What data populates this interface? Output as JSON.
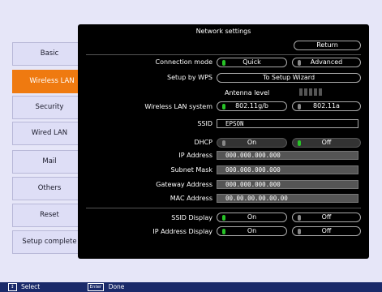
{
  "sidebar": {
    "items": [
      {
        "label": "Basic"
      },
      {
        "label": "Wireless LAN"
      },
      {
        "label": "Security"
      },
      {
        "label": "Wired LAN"
      },
      {
        "label": "Mail"
      },
      {
        "label": "Others"
      },
      {
        "label": "Reset"
      },
      {
        "label": "Setup complete"
      }
    ]
  },
  "panel": {
    "title": "Network settings",
    "return_label": "Return",
    "connection_mode": {
      "label": "Connection mode",
      "option1": "Quick",
      "option2": "Advanced"
    },
    "wps": {
      "label": "Setup by WPS",
      "button": "To Setup Wizard"
    },
    "antenna_label": "Antenna level",
    "wireless_system": {
      "label": "Wireless LAN system",
      "option1": "802.11g/b",
      "option2": "802.11a"
    },
    "ssid": {
      "label": "SSID",
      "value": "EPSON"
    },
    "dhcp": {
      "label": "DHCP",
      "option1": "On",
      "option2": "Off"
    },
    "ip": {
      "label": "IP Address",
      "value": "000.000.000.000"
    },
    "subnet": {
      "label": "Subnet Mask",
      "value": "000.000.000.000"
    },
    "gateway": {
      "label": "Gateway Address",
      "value": "000.000.000.000"
    },
    "mac": {
      "label": "MAC Address",
      "value": "00.00.00.00.00.00"
    },
    "ssid_display": {
      "label": "SSID Display",
      "option1": "On",
      "option2": "Off"
    },
    "ip_display": {
      "label": "IP Address Display",
      "option1": "On",
      "option2": "Off"
    }
  },
  "bottom": {
    "key1": "↕",
    "select_label": "Select",
    "key2": "Enter",
    "done_label": "Done"
  }
}
